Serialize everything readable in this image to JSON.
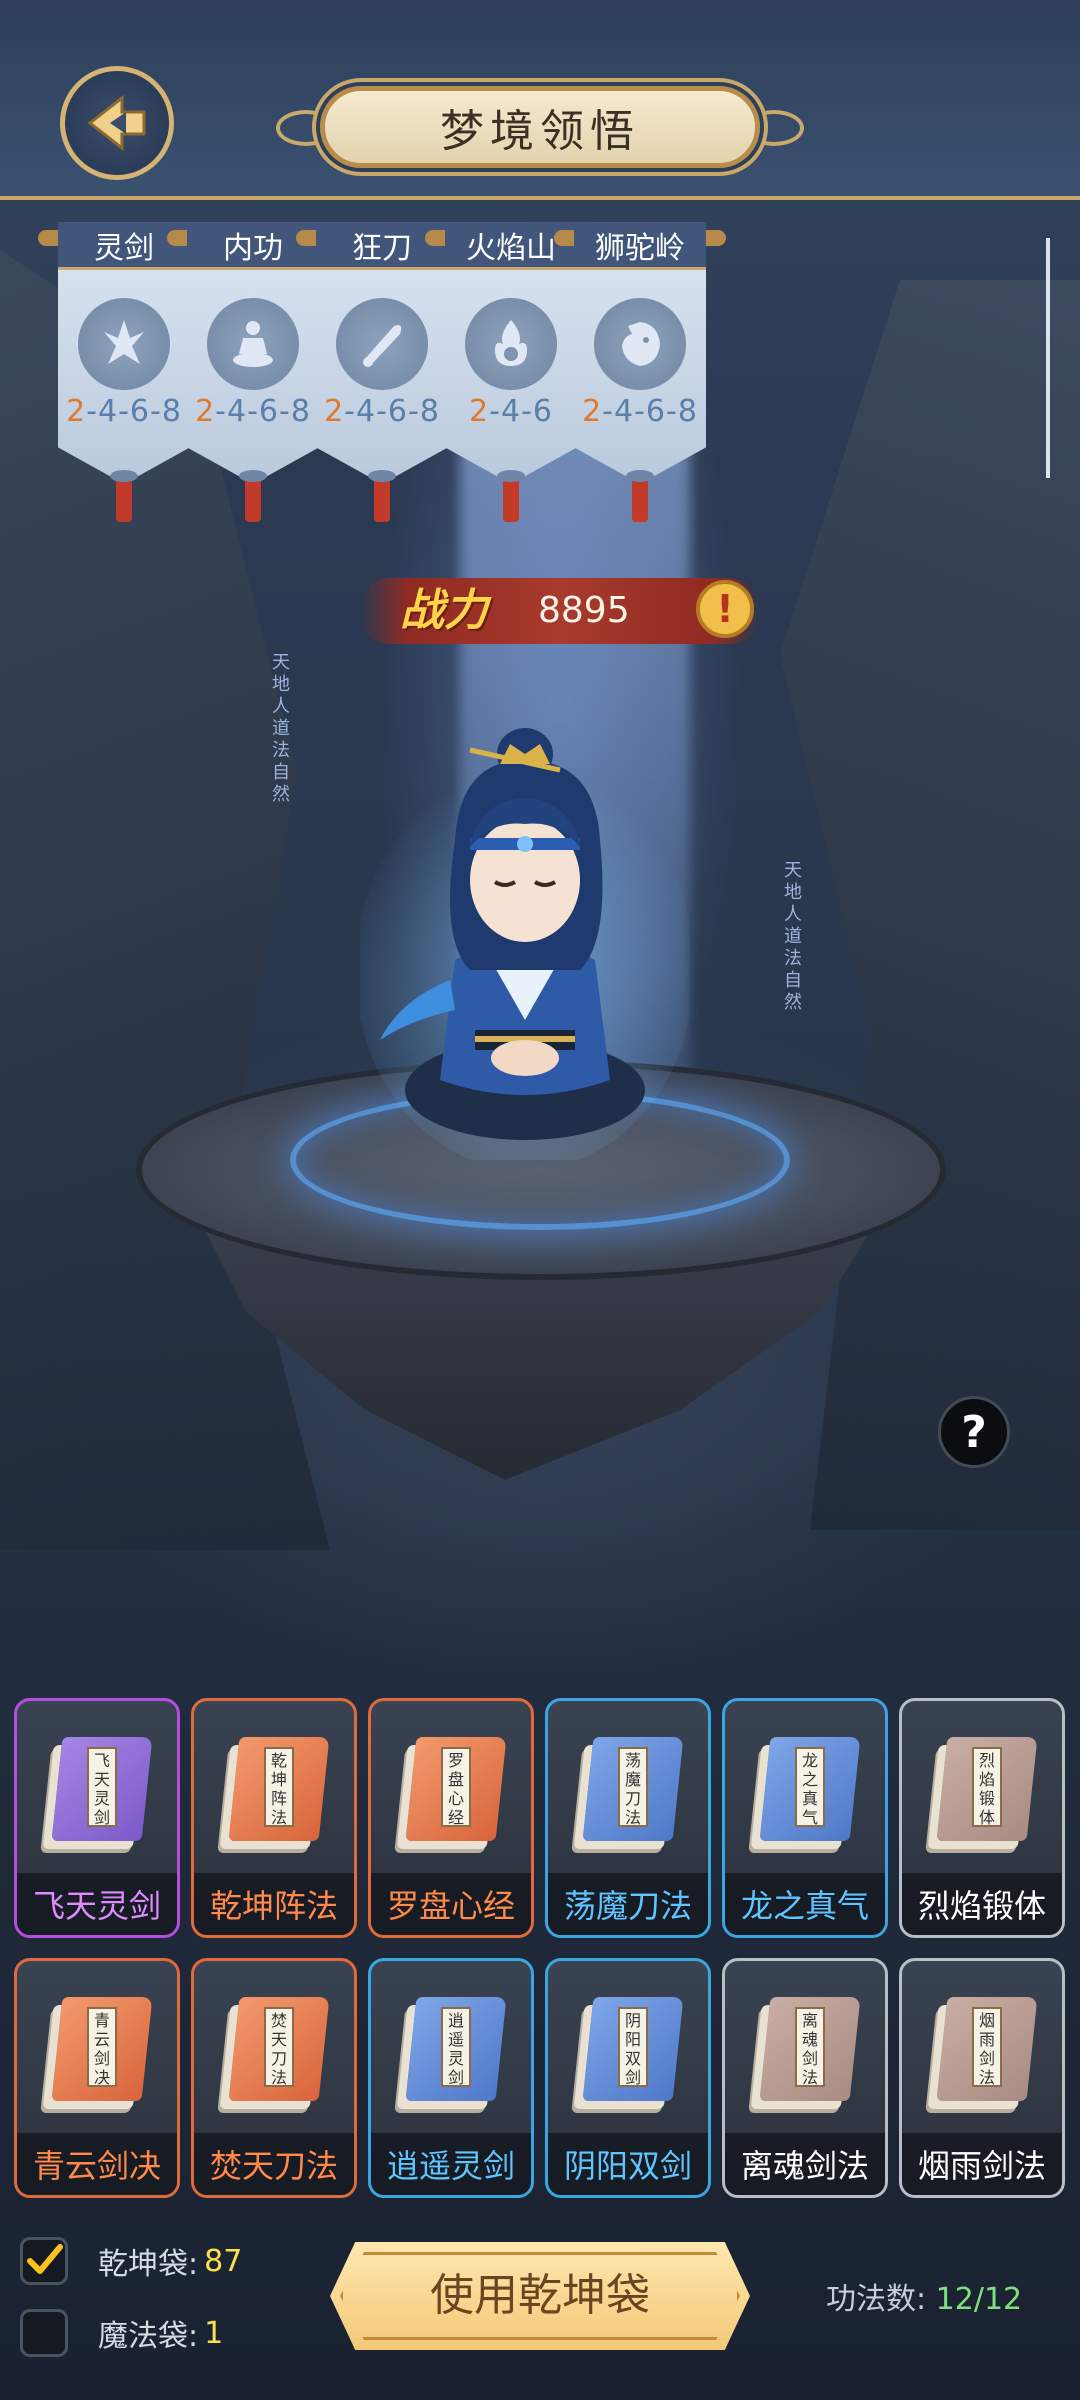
{
  "header": {
    "title": "梦境领悟"
  },
  "banners": [
    {
      "title": "灵剑",
      "levels_first": "2",
      "levels_rest": "-4-6-8",
      "icon": "sword-spirit-icon"
    },
    {
      "title": "内功",
      "levels_first": "2",
      "levels_rest": "-4-6-8",
      "icon": "meditation-icon"
    },
    {
      "title": "狂刀",
      "levels_first": "2",
      "levels_rest": "-4-6-8",
      "icon": "blade-icon"
    },
    {
      "title": "火焰山",
      "levels_first": "2",
      "levels_rest": "-4-6",
      "icon": "flame-icon"
    },
    {
      "title": "狮驼岭",
      "levels_first": "2",
      "levels_rest": "-4-6-8",
      "icon": "lion-icon"
    }
  ],
  "power": {
    "label": "战力",
    "value": "8895"
  },
  "calligraphy": {
    "text": "天地人道法自然"
  },
  "skills": [
    {
      "name": "飞天灵剑",
      "book": "飞天灵剑",
      "rarity": "purple"
    },
    {
      "name": "乾坤阵法",
      "book": "乾坤阵法",
      "rarity": "orange"
    },
    {
      "name": "罗盘心经",
      "book": "罗盘心经",
      "rarity": "orange"
    },
    {
      "name": "荡魔刀法",
      "book": "荡魔刀法",
      "rarity": "blue"
    },
    {
      "name": "龙之真气",
      "book": "龙之真气",
      "rarity": "blue"
    },
    {
      "name": "烈焰锻体",
      "book": "烈焰锻体",
      "rarity": "gray"
    },
    {
      "name": "青云剑决",
      "book": "青云剑决",
      "rarity": "orange"
    },
    {
      "name": "焚天刀法",
      "book": "焚天刀法",
      "rarity": "orange"
    },
    {
      "name": "逍遥灵剑",
      "book": "逍遥灵剑",
      "rarity": "blue"
    },
    {
      "name": "阴阳双剑",
      "book": "阴阳双剑",
      "rarity": "blue"
    },
    {
      "name": "离魂剑法",
      "book": "离魂剑法",
      "rarity": "gray"
    },
    {
      "name": "烟雨剑法",
      "book": "烟雨剑法",
      "rarity": "gray"
    }
  ],
  "footer": {
    "bag1_label": "乾坤袋:",
    "bag1_count": "87",
    "bag1_checked": true,
    "bag2_label": "魔法袋:",
    "bag2_count": "1",
    "bag2_checked": false,
    "use_button": "使用乾坤袋",
    "skill_count_label": "功法数:",
    "skill_count_value": "12/12"
  },
  "colors": {
    "purple": "#b34ee0",
    "orange": "#e06a3a",
    "blue": "#3aa6e0",
    "gray": "#b9bdc4",
    "gold": "#c8a96b"
  }
}
